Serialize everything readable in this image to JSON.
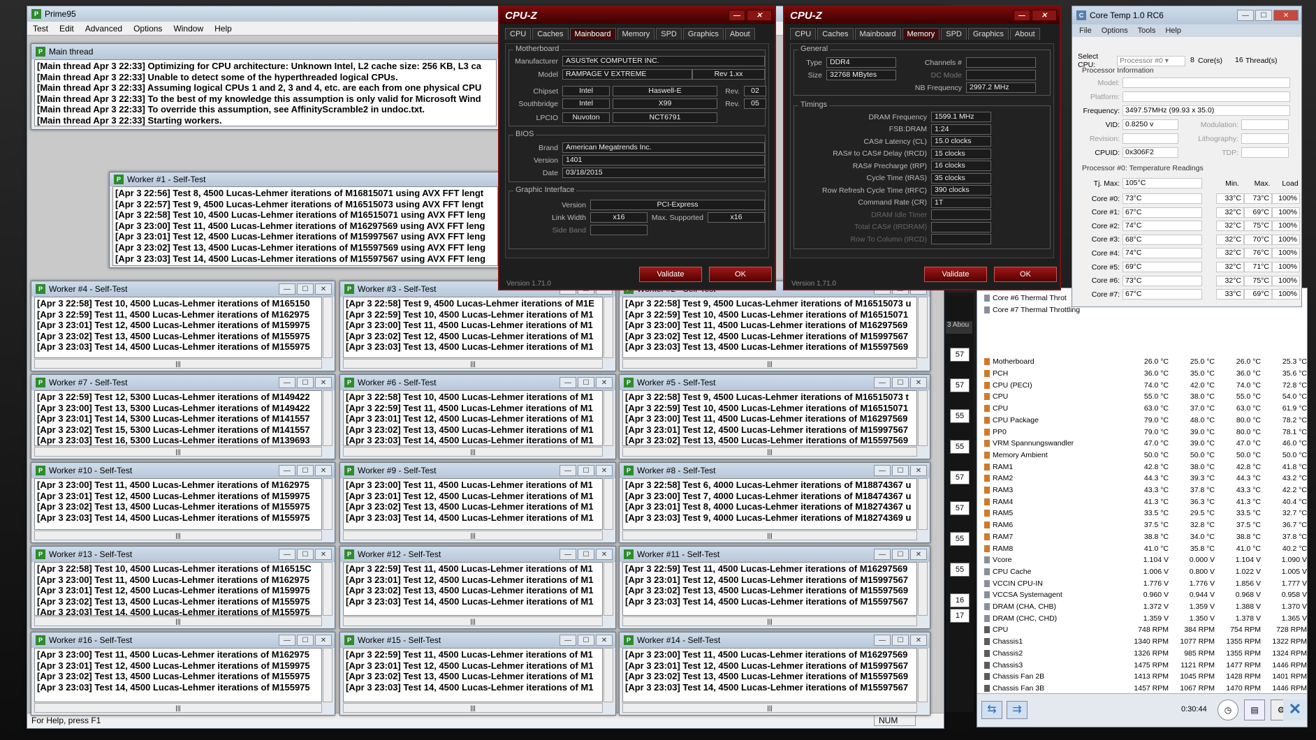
{
  "prime95": {
    "title": "Prime95",
    "menu": [
      "Test",
      "Edit",
      "Advanced",
      "Options",
      "Window",
      "Help"
    ],
    "main_thread": {
      "title": "Main thread",
      "lines": [
        "[Main thread Apr 3 22:33] Optimizing for CPU architecture: Unknown Intel, L2 cache size: 256 KB, L3 ca",
        "[Main thread Apr 3 22:33] Unable to detect some of the hyperthreaded logical CPUs.",
        "[Main thread Apr 3 22:33] Assuming logical CPUs 1 and 2, 3 and 4, etc. are each from one physical CPU",
        "[Main thread Apr 3 22:33] To the best of my knowledge this assumption is only valid for Microsoft Wind",
        "[Main thread Apr 3 22:33] To override this assumption, see AffinityScramble2 in undoc.txt.",
        "[Main thread Apr 3 22:33] Starting workers."
      ]
    },
    "worker1": {
      "title": "Worker #1 - Self-Test",
      "lines": [
        "[Apr 3 22:56] Test 8, 4500 Lucas-Lehmer iterations of M16815071 using AVX FFT lengt",
        "[Apr 3 22:57] Test 9, 4500 Lucas-Lehmer iterations of M16515073 using AVX FFT lengt",
        "[Apr 3 22:58] Test 10, 4500 Lucas-Lehmer iterations of M16515071 using AVX FFT leng",
        "[Apr 3 23:00] Test 11, 4500 Lucas-Lehmer iterations of M16297569 using AVX FFT leng",
        "[Apr 3 23:01] Test 12, 4500 Lucas-Lehmer iterations of M15997567 using AVX FFT leng",
        "[Apr 3 23:02] Test 13, 4500 Lucas-Lehmer iterations of M15597569 using AVX FFT leng",
        "[Apr 3 23:03] Test 14, 4500 Lucas-Lehmer iterations of M15597567 using AVX FFT leng"
      ]
    },
    "workers": [
      {
        "title": "Worker #4 - Self-Test",
        "lines": [
          "[Apr 3 22:58] Test 10, 4500 Lucas-Lehmer iterations of M165150",
          "[Apr 3 22:59] Test 11, 4500 Lucas-Lehmer iterations of M162975",
          "[Apr 3 23:01] Test 12, 4500 Lucas-Lehmer iterations of M159975",
          "[Apr 3 23:02] Test 13, 4500 Lucas-Lehmer iterations of M155975",
          "[Apr 3 23:03] Test 14, 4500 Lucas-Lehmer iterations of M155975"
        ]
      },
      {
        "title": "Worker #3 - Self-Test",
        "lines": [
          "[Apr 3 22:58] Test 9, 4500 Lucas-Lehmer iterations of M1E",
          "[Apr 3 22:59] Test 10, 4500 Lucas-Lehmer iterations of M1",
          "[Apr 3 23:00] Test 11, 4500 Lucas-Lehmer iterations of M1",
          "[Apr 3 23:02] Test 12, 4500 Lucas-Lehmer iterations of M1",
          "[Apr 3 23:03] Test 13, 4500 Lucas-Lehmer iterations of M1"
        ]
      },
      {
        "title": "Worker #2 - Self-Test",
        "lines": [
          "[Apr 3 22:58] Test 9, 4500 Lucas-Lehmer iterations of M16515073 u",
          "[Apr 3 22:59] Test 10, 4500 Lucas-Lehmer iterations of M16515071",
          "[Apr 3 23:00] Test 11, 4500 Lucas-Lehmer iterations of M16297569",
          "[Apr 3 23:02] Test 12, 4500 Lucas-Lehmer iterations of M15997567",
          "[Apr 3 23:03] Test 13, 4500 Lucas-Lehmer iterations of M15597569"
        ]
      },
      {
        "title": "Worker #7 - Self-Test",
        "lines": [
          "[Apr 3 22:59] Test 12, 5300 Lucas-Lehmer iterations of M149422",
          "[Apr 3 23:00] Test 13, 5300 Lucas-Lehmer iterations of M149422",
          "[Apr 3 23:01] Test 14, 5300 Lucas-Lehmer iterations of M141557",
          "[Apr 3 23:02] Test 15, 5300 Lucas-Lehmer iterations of M141557",
          "[Apr 3 23:03] Test 16, 5300 Lucas-Lehmer iterations of M139693"
        ]
      },
      {
        "title": "Worker #6 - Self-Test",
        "lines": [
          "[Apr 3 22:58] Test 10, 4500 Lucas-Lehmer iterations of M1",
          "[Apr 3 22:59] Test 11, 4500 Lucas-Lehmer iterations of M1",
          "[Apr 3 23:01] Test 12, 4500 Lucas-Lehmer iterations of M1",
          "[Apr 3 23:02] Test 13, 4500 Lucas-Lehmer iterations of M1",
          "[Apr 3 23:03] Test 14, 4500 Lucas-Lehmer iterations of M1"
        ]
      },
      {
        "title": "Worker #5 - Self-Test",
        "lines": [
          "[Apr 3 22:58] Test 9, 4500 Lucas-Lehmer iterations of M16515073 t",
          "[Apr 3 22:59] Test 10, 4500 Lucas-Lehmer iterations of M16515071",
          "[Apr 3 23:00] Test 11, 4500 Lucas-Lehmer iterations of M16297569",
          "[Apr 3 23:01] Test 12, 4500 Lucas-Lehmer iterations of M15997567",
          "[Apr 3 23:02] Test 13, 4500 Lucas-Lehmer iterations of M15597569"
        ]
      },
      {
        "title": "Worker #10 - Self-Test",
        "lines": [
          "[Apr 3 23:00] Test 11, 4500 Lucas-Lehmer iterations of M162975",
          "[Apr 3 23:01] Test 12, 4500 Lucas-Lehmer iterations of M159975",
          "[Apr 3 23:02] Test 13, 4500 Lucas-Lehmer iterations of M155975",
          "[Apr 3 23:03] Test 14, 4500 Lucas-Lehmer iterations of M155975"
        ]
      },
      {
        "title": "Worker #9 - Self-Test",
        "lines": [
          "[Apr 3 23:00] Test 11, 4500 Lucas-Lehmer iterations of M1",
          "[Apr 3 23:01] Test 12, 4500 Lucas-Lehmer iterations of M1",
          "[Apr 3 23:02] Test 13, 4500 Lucas-Lehmer iterations of M1",
          "[Apr 3 23:03] Test 14, 4500 Lucas-Lehmer iterations of M1"
        ]
      },
      {
        "title": "Worker #8 - Self-Test",
        "lines": [
          "[Apr 3 22:58] Test 6, 4000 Lucas-Lehmer iterations of M18874367 u",
          "[Apr 3 23:00] Test 7, 4000 Lucas-Lehmer iterations of M18474367 u",
          "[Apr 3 23:01] Test 8, 4000 Lucas-Lehmer iterations of M18274367 u",
          "[Apr 3 23:03] Test 9, 4000 Lucas-Lehmer iterations of M18274369 u"
        ]
      },
      {
        "title": "Worker #13 - Self-Test",
        "lines": [
          "[Apr 3 22:58] Test 10, 4500 Lucas-Lehmer iterations of M16515C",
          "[Apr 3 23:00] Test 11, 4500 Lucas-Lehmer iterations of M162975",
          "[Apr 3 23:01] Test 12, 4500 Lucas-Lehmer iterations of M159975",
          "[Apr 3 23:02] Test 13, 4500 Lucas-Lehmer iterations of M155975",
          "[Apr 3 23:03] Test 14, 4500 Lucas-Lehmer iterations of M155975"
        ]
      },
      {
        "title": "Worker #12 - Self-Test",
        "lines": [
          "[Apr 3 22:59] Test 11, 4500 Lucas-Lehmer iterations of M1",
          "[Apr 3 23:01] Test 12, 4500 Lucas-Lehmer iterations of M1",
          "[Apr 3 23:02] Test 13, 4500 Lucas-Lehmer iterations of M1",
          "[Apr 3 23:03] Test 14, 4500 Lucas-Lehmer iterations of M1"
        ]
      },
      {
        "title": "Worker #11 - Self-Test",
        "lines": [
          "[Apr 3 22:59] Test 11, 4500 Lucas-Lehmer iterations of M16297569",
          "[Apr 3 23:01] Test 12, 4500 Lucas-Lehmer iterations of M15997567",
          "[Apr 3 23:02] Test 13, 4500 Lucas-Lehmer iterations of M15597569",
          "[Apr 3 23:03] Test 14, 4500 Lucas-Lehmer iterations of M15597567"
        ]
      },
      {
        "title": "Worker #16 - Self-Test",
        "lines": [
          "[Apr 3 23:00] Test 11, 4500 Lucas-Lehmer iterations of M162975",
          "[Apr 3 23:01] Test 12, 4500 Lucas-Lehmer iterations of M159975",
          "[Apr 3 23:02] Test 13, 4500 Lucas-Lehmer iterations of M155975",
          "[Apr 3 23:03] Test 14, 4500 Lucas-Lehmer iterations of M155975"
        ]
      },
      {
        "title": "Worker #15 - Self-Test",
        "lines": [
          "[Apr 3 22:59] Test 11, 4500 Lucas-Lehmer iterations of M1",
          "[Apr 3 23:01] Test 12, 4500 Lucas-Lehmer iterations of M1",
          "[Apr 3 23:02] Test 13, 4500 Lucas-Lehmer iterations of M1",
          "[Apr 3 23:03] Test 14, 4500 Lucas-Lehmer iterations of M1"
        ]
      },
      {
        "title": "Worker #14 - Self-Test",
        "lines": [
          "[Apr 3 23:00] Test 11, 4500 Lucas-Lehmer iterations of M16297569",
          "[Apr 3 23:01] Test 12, 4500 Lucas-Lehmer iterations of M15997567",
          "[Apr 3 23:02] Test 13, 4500 Lucas-Lehmer iterations of M15597569",
          "[Apr 3 23:03] Test 14, 4500 Lucas-Lehmer iterations of M15597567"
        ]
      }
    ],
    "status_bar": "For Help, press F1",
    "num_indicator": "NUM"
  },
  "cpuz1": {
    "title": "CPU-Z",
    "tabs": [
      "CPU",
      "Caches",
      "Mainboard",
      "Memory",
      "SPD",
      "Graphics",
      "About"
    ],
    "active": "Mainboard",
    "motherboard": {
      "label": "Motherboard",
      "manufacturer_l": "Manufacturer",
      "manufacturer": "ASUSTeK COMPUTER INC.",
      "model_l": "Model",
      "model": "RAMPAGE V EXTREME",
      "model_rev": "Rev 1.xx",
      "chipset_l": "Chipset",
      "chipset_v": "Intel",
      "chipset_n": "Haswell-E",
      "rev_l": "Rev.",
      "chipset_rev": "02",
      "southbridge_l": "Southbridge",
      "sb_v": "Intel",
      "sb_n": "X99",
      "sb_rev": "05",
      "lpcio_l": "LPCIO",
      "lpcio_v": "Nuvoton",
      "lpcio_n": "NCT6791"
    },
    "bios": {
      "label": "BIOS",
      "brand_l": "Brand",
      "brand": "American Megatrends Inc.",
      "version_l": "Version",
      "version": "1401",
      "date_l": "Date",
      "date": "03/18/2015"
    },
    "graphic": {
      "label": "Graphic Interface",
      "version_l": "Version",
      "version": "PCI-Express",
      "link_l": "Link Width",
      "link": "x16",
      "max_l": "Max. Supported",
      "max": "x16",
      "side_l": "Side Band"
    },
    "validate": "Validate",
    "ok": "OK",
    "version": "Version 1.71.0"
  },
  "cpuz2": {
    "title": "CPU-Z",
    "tabs": [
      "CPU",
      "Caches",
      "Mainboard",
      "Memory",
      "SPD",
      "Graphics",
      "About"
    ],
    "active": "Memory",
    "general": {
      "label": "General",
      "type_l": "Type",
      "type": "DDR4",
      "channels_l": "Channels #",
      "size_l": "Size",
      "size": "32768 MBytes",
      "dc_l": "DC Mode",
      "nb_l": "NB Frequency",
      "nb": "2997.2 MHz"
    },
    "timings": {
      "label": "Timings",
      "rows": [
        {
          "l": "DRAM Frequency",
          "v": "1599.1 MHz"
        },
        {
          "l": "FSB:DRAM",
          "v": "1:24"
        },
        {
          "l": "CAS# Latency (CL)",
          "v": "15.0 clocks"
        },
        {
          "l": "RAS# to CAS# Delay (tRCD)",
          "v": "15 clocks"
        },
        {
          "l": "RAS# Precharge (tRP)",
          "v": "16 clocks"
        },
        {
          "l": "Cycle Time (tRAS)",
          "v": "35 clocks"
        },
        {
          "l": "Row Refresh Cycle Time (tRFC)",
          "v": "390 clocks"
        },
        {
          "l": "Command Rate (CR)",
          "v": "1T"
        },
        {
          "l": "DRAM Idle Timer",
          "v": ""
        },
        {
          "l": "Total CAS# (tRDRAM)",
          "v": ""
        },
        {
          "l": "Row To Column (tRCD)",
          "v": ""
        }
      ]
    },
    "validate": "Validate",
    "ok": "OK",
    "version": "Version 1.71.0"
  },
  "coretemp": {
    "title": "Core Temp 1.0 RC6",
    "menu": [
      "File",
      "Options",
      "Tools",
      "Help"
    ],
    "select_cpu_l": "Select CPU:",
    "select_cpu": "Processor #0",
    "cores": "8",
    "cores_l": "Core(s)",
    "threads": "16",
    "threads_l": "Thread(s)",
    "info_label": "Processor Information",
    "model_l": "Model:",
    "platform_l": "Platform:",
    "freq_l": "Frequency:",
    "freq": "3497.57MHz (99.93 x 35.0)",
    "vid_l": "VID:",
    "vid": "0.8250 v",
    "modulation_l": "Modulation:",
    "revision_l": "Revision:",
    "litho_l": "Lithography:",
    "cpuid_l": "CPUID:",
    "cpuid": "0x306F2",
    "tdp_l": "TDP:",
    "temp_label": "Processor #0: Temperature Readings",
    "tjmax_l": "Tj. Max:",
    "tjmax": "105°C",
    "min_h": "Min.",
    "max_h": "Max.",
    "load_h": "Load",
    "cores_list": [
      {
        "n": "Core #0:",
        "t": "73°C",
        "min": "33°C",
        "max": "73°C",
        "load": "100%"
      },
      {
        "n": "Core #1:",
        "t": "67°C",
        "min": "32°C",
        "max": "69°C",
        "load": "100%"
      },
      {
        "n": "Core #2:",
        "t": "74°C",
        "min": "32°C",
        "max": "75°C",
        "load": "100%"
      },
      {
        "n": "Core #3:",
        "t": "68°C",
        "min": "32°C",
        "max": "70°C",
        "load": "100%"
      },
      {
        "n": "Core #4:",
        "t": "74°C",
        "min": "32°C",
        "max": "76°C",
        "load": "100%"
      },
      {
        "n": "Core #5:",
        "t": "69°C",
        "min": "32°C",
        "max": "71°C",
        "load": "100%"
      },
      {
        "n": "Core #6:",
        "t": "73°C",
        "min": "32°C",
        "max": "75°C",
        "load": "100%"
      },
      {
        "n": "Core #7:",
        "t": "67°C",
        "min": "33°C",
        "max": "69°C",
        "load": "100%"
      }
    ]
  },
  "hwinfo": {
    "partial_rows": [
      "Core #6 Thermal Throt",
      "Core #7 Thermal Throttling"
    ],
    "sensors": [
      {
        "n": "Motherboard",
        "c": "26.0 °C",
        "mi": "25.0 °C",
        "ma": "26.0 °C",
        "av": "25.3 °C",
        "k": "t"
      },
      {
        "n": "PCH",
        "c": "36.0 °C",
        "mi": "35.0 °C",
        "ma": "36.0 °C",
        "av": "35.6 °C",
        "k": "t"
      },
      {
        "n": "CPU (PECI)",
        "c": "74.0 °C",
        "mi": "42.0 °C",
        "ma": "74.0 °C",
        "av": "72.8 °C",
        "k": "t"
      },
      {
        "n": "CPU",
        "c": "55.0 °C",
        "mi": "38.0 °C",
        "ma": "55.0 °C",
        "av": "54.0 °C",
        "k": "t"
      },
      {
        "n": "CPU",
        "c": "63.0 °C",
        "mi": "37.0 °C",
        "ma": "63.0 °C",
        "av": "61.9 °C",
        "k": "t"
      },
      {
        "n": "CPU Package",
        "c": "79.0 °C",
        "mi": "48.0 °C",
        "ma": "80.0 °C",
        "av": "78.2 °C",
        "k": "t"
      },
      {
        "n": "PP0",
        "c": "79.0 °C",
        "mi": "39.0 °C",
        "ma": "80.0 °C",
        "av": "78.1 °C",
        "k": "t"
      },
      {
        "n": "VRM Spannungswandler",
        "c": "47.0 °C",
        "mi": "39.0 °C",
        "ma": "47.0 °C",
        "av": "46.0 °C",
        "k": "t"
      },
      {
        "n": "Memory Ambient",
        "c": "50.0 °C",
        "mi": "50.0 °C",
        "ma": "50.0 °C",
        "av": "50.0 °C",
        "k": "t"
      },
      {
        "n": "RAM1",
        "c": "42.8 °C",
        "mi": "38.0 °C",
        "ma": "42.8 °C",
        "av": "41.8 °C",
        "k": "t"
      },
      {
        "n": "RAM2",
        "c": "44.3 °C",
        "mi": "39.3 °C",
        "ma": "44.3 °C",
        "av": "43.2 °C",
        "k": "t"
      },
      {
        "n": "RAM3",
        "c": "43.3 °C",
        "mi": "37.8 °C",
        "ma": "43.3 °C",
        "av": "42.2 °C",
        "k": "t"
      },
      {
        "n": "RAM4",
        "c": "41.3 °C",
        "mi": "36.3 °C",
        "ma": "41.3 °C",
        "av": "40.4 °C",
        "k": "t"
      },
      {
        "n": "RAM5",
        "c": "33.5 °C",
        "mi": "29.5 °C",
        "ma": "33.5 °C",
        "av": "32.7 °C",
        "k": "t"
      },
      {
        "n": "RAM6",
        "c": "37.5 °C",
        "mi": "32.8 °C",
        "ma": "37.5 °C",
        "av": "36.7 °C",
        "k": "t"
      },
      {
        "n": "RAM7",
        "c": "38.8 °C",
        "mi": "34.0 °C",
        "ma": "38.8 °C",
        "av": "37.8 °C",
        "k": "t"
      },
      {
        "n": "RAM8",
        "c": "41.0 °C",
        "mi": "35.8 °C",
        "ma": "41.0 °C",
        "av": "40.2 °C",
        "k": "t"
      },
      {
        "n": "Vcore",
        "c": "1.104 V",
        "mi": "0.000 V",
        "ma": "1.104 V",
        "av": "1.090 V",
        "k": "v"
      },
      {
        "n": "CPU Cache",
        "c": "1.006 V",
        "mi": "0.800 V",
        "ma": "1.022 V",
        "av": "1.005 V",
        "k": "v"
      },
      {
        "n": "VCCIN CPU-IN",
        "c": "1.776 V",
        "mi": "1.776 V",
        "ma": "1.856 V",
        "av": "1.777 V",
        "k": "v"
      },
      {
        "n": "VCCSA Systemagent",
        "c": "0.960 V",
        "mi": "0.944 V",
        "ma": "0.968 V",
        "av": "0.958 V",
        "k": "v"
      },
      {
        "n": "DRAM (CHA, CHB)",
        "c": "1.372 V",
        "mi": "1.359 V",
        "ma": "1.388 V",
        "av": "1.370 V",
        "k": "v"
      },
      {
        "n": "DRAM (CHC, CHD)",
        "c": "1.359 V",
        "mi": "1.350 V",
        "ma": "1.378 V",
        "av": "1.365 V",
        "k": "v"
      },
      {
        "n": "CPU",
        "c": "748 RPM",
        "mi": "384 RPM",
        "ma": "754 RPM",
        "av": "728 RPM",
        "k": "f"
      },
      {
        "n": "Chassis1",
        "c": "1340 RPM",
        "mi": "1077 RPM",
        "ma": "1355 RPM",
        "av": "1322 RPM",
        "k": "f"
      },
      {
        "n": "Chassis2",
        "c": "1326 RPM",
        "mi": "985 RPM",
        "ma": "1355 RPM",
        "av": "1324 RPM",
        "k": "f"
      },
      {
        "n": "Chassis3",
        "c": "1475 RPM",
        "mi": "1121 RPM",
        "ma": "1477 RPM",
        "av": "1446 RPM",
        "k": "f"
      },
      {
        "n": "Chassis Fan 2B",
        "c": "1413 RPM",
        "mi": "1045 RPM",
        "ma": "1428 RPM",
        "av": "1401 RPM",
        "k": "f"
      },
      {
        "n": "Chassis Fan 3B",
        "c": "1457 RPM",
        "mi": "1067 RPM",
        "ma": "1470 RPM",
        "av": "1446 RPM",
        "k": "f"
      }
    ],
    "timer": "0:30:44",
    "side_values": [
      "57",
      "57",
      "55",
      "55",
      "57",
      "57",
      "55",
      "55",
      "16",
      "17"
    ],
    "tab_partial": "Abou",
    "tab_num": "3"
  }
}
